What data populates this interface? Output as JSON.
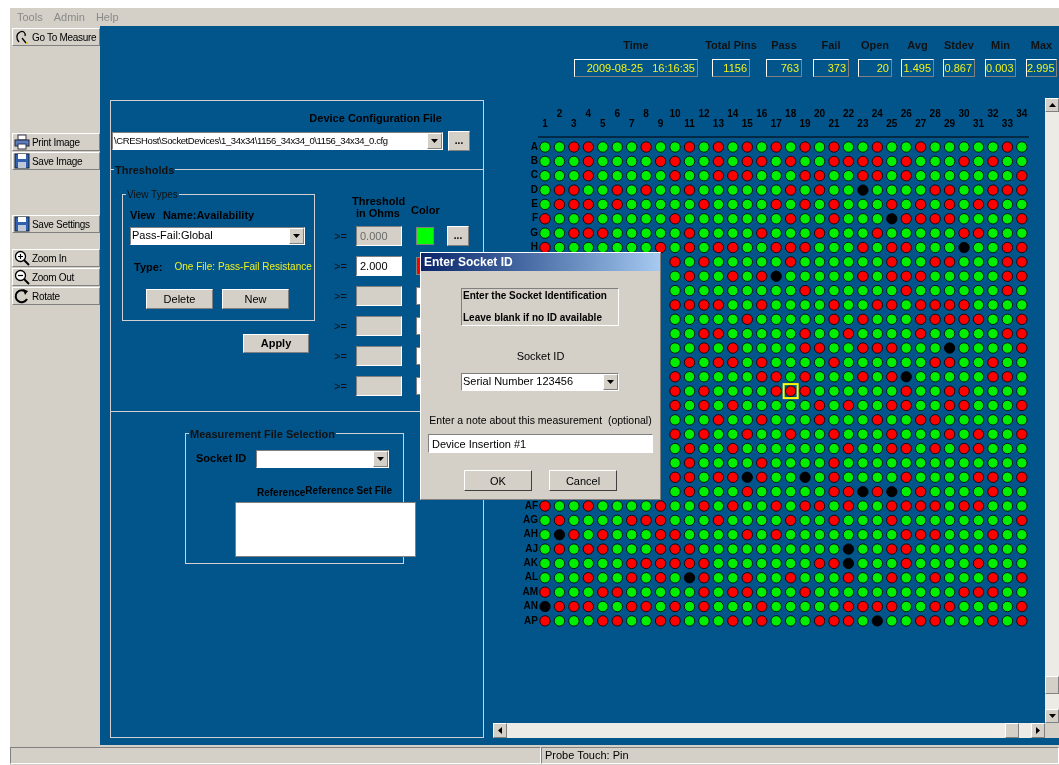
{
  "menu": [
    {
      "label": "Tools",
      "disabled": true
    },
    {
      "label": "Admin",
      "disabled": true
    },
    {
      "label": "Help",
      "disabled": true
    }
  ],
  "toolbar_groups": [
    [
      {
        "label": "Go To Measure"
      }
    ],
    [
      {
        "label": "Print Image"
      },
      {
        "label": "Save Image"
      }
    ],
    [
      {
        "label": "Save Settings"
      }
    ],
    [
      {
        "label": "Zoom In"
      },
      {
        "label": "Zoom Out"
      },
      {
        "label": "Rotate"
      }
    ]
  ],
  "config": {
    "title": "Device Configuration File",
    "path": "\\CRESHost\\SocketDevices\\1_34x34\\1156_34x34_0\\1156_34x34_0.cfg",
    "browse": "...",
    "thresholds_title": "Thresholds",
    "view_types": {
      "legend": "View Types",
      "view_label": "View",
      "name": "Name:Availability",
      "selected_view": "Pass-Fail:Global",
      "type_label": "Type:",
      "type_value": "One File: Pass-Fail Resistance",
      "buttons": [
        "Delete",
        "New"
      ]
    },
    "threshold_heading": "Threshold in Ohms",
    "color_heading": "Color",
    "threshold_rows": [
      {
        "op": ">=",
        "value": "0.000",
        "disabled": true,
        "color": "#00ff00",
        "browse": "..."
      },
      {
        "op": ">=",
        "value": "2.000",
        "disabled": false,
        "color": "#ff0000"
      },
      {
        "op": ">=",
        "disabled": true,
        "color": "#ffffff"
      },
      {
        "op": ">=",
        "disabled": true,
        "color": "#ffffff"
      },
      {
        "op": ">=",
        "disabled": true,
        "color": "#ffffff"
      },
      {
        "op": ">=",
        "disabled": true,
        "color": "#ffffff"
      }
    ],
    "apply": "Apply",
    "measurement": {
      "legend": "Measurement File Selection",
      "socket_label": "Socket ID",
      "reference": "Reference",
      "reference_set": "Reference Set File"
    }
  },
  "stats": [
    {
      "label": "Time",
      "value": "2009-08-25   16:16:35"
    },
    {
      "label": "Total Pins",
      "value": "1156"
    },
    {
      "label": "Pass",
      "value": "763"
    },
    {
      "label": "Fail",
      "value": "373"
    },
    {
      "label": "Open",
      "value": "20"
    },
    {
      "label": "Avg",
      "value": "1.495"
    },
    {
      "label": "Stdev",
      "value": "0.867"
    },
    {
      "label": "Min",
      "value": "0.003"
    },
    {
      "label": "Max",
      "value": "2.995"
    }
  ],
  "pin_map": {
    "column_labels": [
      "1",
      "2",
      "3",
      "4",
      "5",
      "6",
      "7",
      "8",
      "9",
      "10",
      "11",
      "12",
      "13",
      "14",
      "15",
      "16",
      "17",
      "18",
      "19",
      "20",
      "21",
      "22",
      "23",
      "24",
      "25",
      "26",
      "27",
      "28",
      "29",
      "30",
      "31",
      "32",
      "33",
      "34"
    ],
    "row_labels_top": [
      "A",
      "B",
      "C",
      "D",
      "E",
      "F",
      "G",
      "H"
    ],
    "row_labels_bottom": [
      "AF",
      "AG",
      "AH",
      "AJ",
      "AK",
      "AL",
      "AM",
      "AN",
      "AP"
    ]
  },
  "dialog": {
    "title": "Enter Socket ID",
    "instructions": [
      "Enter the Socket Identification",
      "Leave blank if no ID available"
    ],
    "socket_label": "Socket ID",
    "socket_value": "Serial Number 123456",
    "note_label": "Enter a note about this measurement  (optional)",
    "note_value": "Device Insertion #1",
    "buttons": [
      "OK",
      "Cancel"
    ]
  },
  "status_bar": {
    "text": "Probe Touch: Pin"
  }
}
